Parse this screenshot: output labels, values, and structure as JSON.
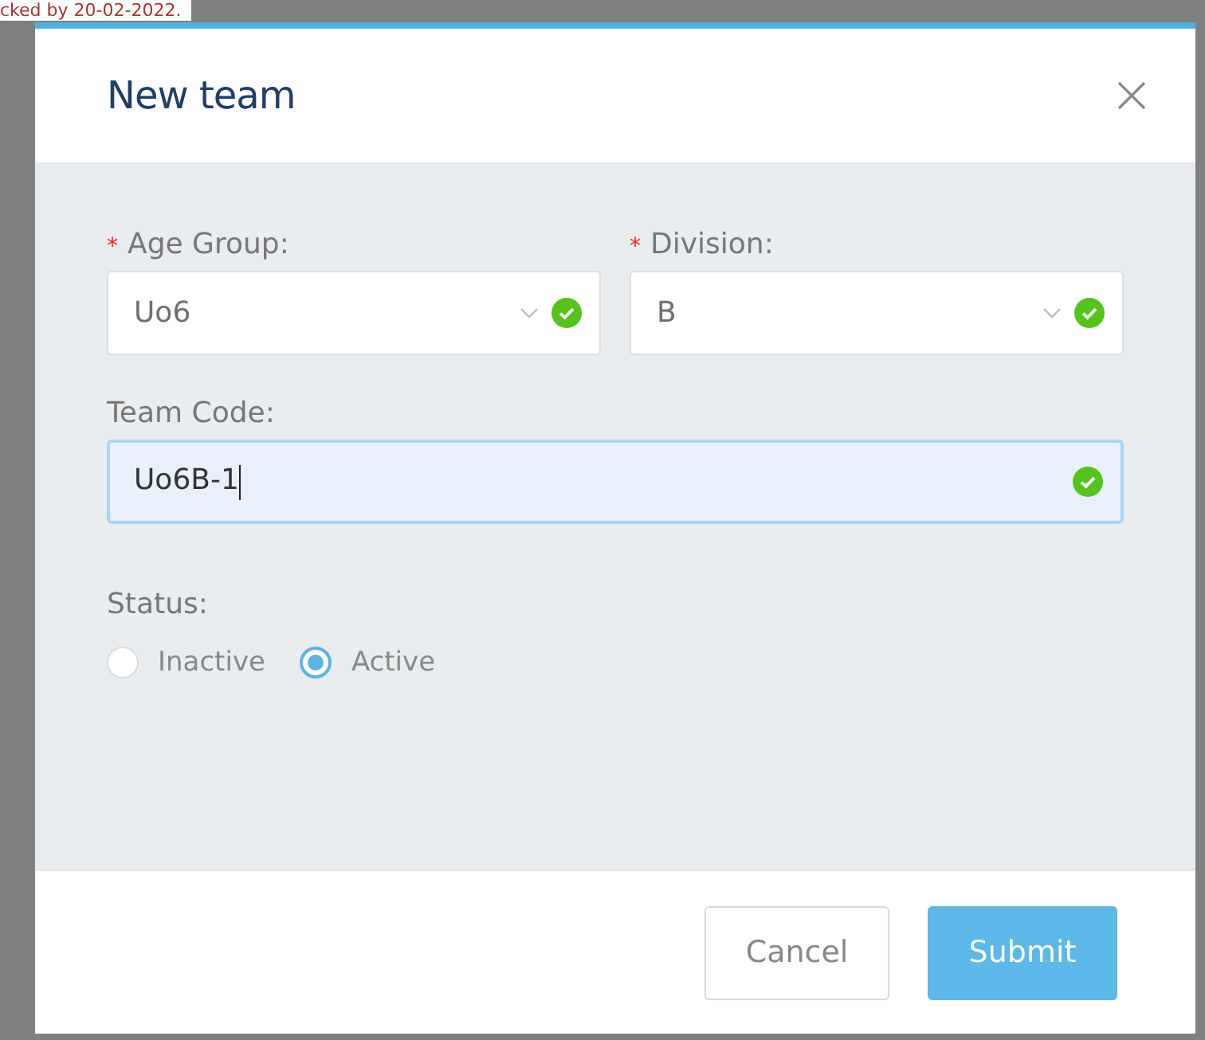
{
  "background_text": "cked by 20-02-2022.",
  "dialog": {
    "title": "New team"
  },
  "fields": [
    {
      "label": "Age Group:",
      "required_mark": "*",
      "kind": "select",
      "value": "Uo6",
      "valid": true,
      "focused": false
    },
    {
      "label": "Division:",
      "required_mark": "*",
      "kind": "select",
      "value": "B",
      "valid": true,
      "focused": false
    },
    {
      "label": "Team Code:",
      "kind": "text",
      "value": "Uo6B-1",
      "valid": true,
      "focused": true
    }
  ],
  "status": {
    "label": "Status:",
    "options": [
      {
        "label": "Inactive",
        "selected": false
      },
      {
        "label": "Active",
        "selected": true
      }
    ]
  },
  "buttons": [
    {
      "label": "Cancel",
      "kind": "default"
    },
    {
      "label": "Submit",
      "kind": "primary"
    }
  ]
}
